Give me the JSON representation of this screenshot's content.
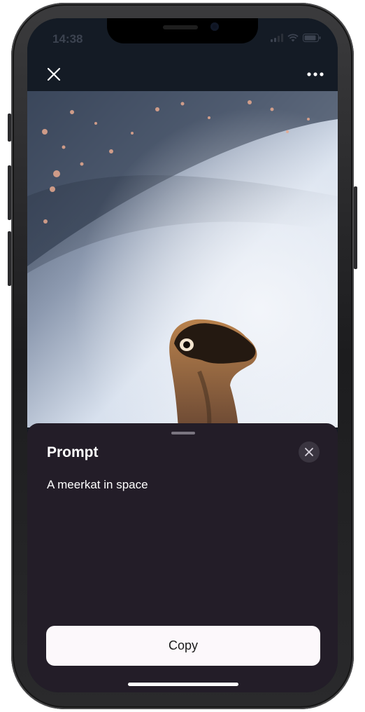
{
  "status_bar": {
    "time": "14:38"
  },
  "toolbar": {
    "close_icon": "close-icon",
    "more_icon": "more-horizontal-icon"
  },
  "image": {
    "description_icon": "generated-image"
  },
  "prompt_sheet": {
    "title": "Prompt",
    "prompt": "A meerkat in space",
    "copy_label": "Copy",
    "close_icon": "close-icon"
  },
  "colors": {
    "sheet_background": "#231d28",
    "copy_button_background": "#fcf8fb",
    "toolbar_background": "#141b25"
  }
}
